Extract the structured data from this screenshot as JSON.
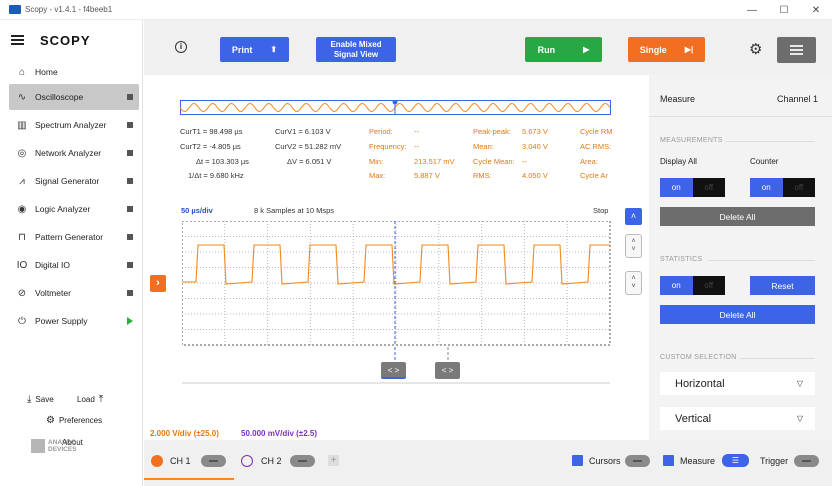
{
  "window": {
    "title": "Scopy - v1.4.1 - f4beeb1",
    "min_glyph": "—",
    "max_glyph": "☐",
    "close_glyph": "✕"
  },
  "sidebar": {
    "brand": "SCOPY",
    "home": "Home",
    "items": [
      {
        "label": "Oscilloscope",
        "icon": "oscilloscope-icon",
        "status": "stopped"
      },
      {
        "label": "Spectrum Analyzer",
        "icon": "spectrum-analyzer-icon",
        "status": "stopped"
      },
      {
        "label": "Network Analyzer",
        "icon": "network-analyzer-icon",
        "status": "stopped"
      },
      {
        "label": "Signal Generator",
        "icon": "signal-generator-icon",
        "status": "stopped"
      },
      {
        "label": "Logic Analyzer",
        "icon": "logic-analyzer-icon",
        "status": "stopped"
      },
      {
        "label": "Pattern Generator",
        "icon": "pattern-generator-icon",
        "status": "stopped"
      },
      {
        "label": "Digital IO",
        "icon": "digital-io-icon",
        "status": "stopped"
      },
      {
        "label": "Voltmeter",
        "icon": "voltmeter-icon",
        "status": "stopped"
      },
      {
        "label": "Power Supply",
        "icon": "power-supply-icon",
        "status": "running"
      }
    ],
    "save": "Save",
    "load": "Load",
    "preferences": "Preferences",
    "about": "About",
    "logo_line1": "ANALOG",
    "logo_line2": "DEVICES"
  },
  "toolbar": {
    "print": "Print",
    "mixed_signal_line1": "Enable Mixed",
    "mixed_signal_line2": "Signal View",
    "run": "Run",
    "single": "Single",
    "colors": {
      "blue": "#3d63e6",
      "green": "#27a844",
      "orange": "#f26f21"
    }
  },
  "cursors": {
    "curT1": "CurT1 = 98.498 µs",
    "curT2": "CurT2 = -4.805 µs",
    "deltaT": "Δt = 103.303 µs",
    "invDeltaT": "1/Δt = 9.680 kHz",
    "curV1": "CurV1 = 6.103 V",
    "curV2": "CurV2 = 51.282 mV",
    "deltaV": "ΔV = 6.051 V"
  },
  "measurements": {
    "period_label": "Period:",
    "period_value": "--",
    "frequency_label": "Frequency:",
    "frequency_value": "--",
    "min_label": "Min:",
    "min_value": "213.517 mV",
    "max_label": "Max:",
    "max_value": "5.887 V",
    "pkpk_label": "Peak-peak:",
    "pkpk_value": "5.673 V",
    "mean_label": "Mean:",
    "mean_value": "3.040 V",
    "cycle_mean_label": "Cycle Mean:",
    "cycle_mean_value": "--",
    "rms_label": "RMS:",
    "rms_value": "4.050 V",
    "cycle_rms_label": "Cycle RM",
    "ac_rms_label": "AC RMS:",
    "area_label": "Area:",
    "cycle_area_label": "Cycle Ar"
  },
  "plot": {
    "timebase": "50 µs/div",
    "samples": "8 k Samples at 10 Msps",
    "status": "Stop",
    "ch1_scale": "2.000 V/div (±25.0)",
    "ch2_scale": "50.000 mV/div (±2.5)",
    "trigger_marker_glyph": "›",
    "cursor_handle_glyph": "< >",
    "scroll_up": "˄",
    "scroll_down": "˅",
    "colors": {
      "ch1": "#f28a1e",
      "ch2": "#7b2fbf",
      "cursor": "#3d63e6"
    }
  },
  "right_panel": {
    "title": "Measure",
    "channel": "Channel 1",
    "measurements_section": "MEASUREMENTS",
    "display_all": "Display All",
    "counter": "Counter",
    "toggle_on": "on",
    "toggle_off": "off",
    "delete_all": "Delete All",
    "statistics_section": "STATISTICS",
    "reset": "Reset",
    "custom_section": "CUSTOM SELECTION",
    "horizontal": "Horizontal",
    "vertical": "Vertical"
  },
  "bottom": {
    "ch1": "CH 1",
    "ch2": "CH 2",
    "add_glyph": "+",
    "cursors": "Cursors",
    "measure": "Measure",
    "trigger": "Trigger"
  }
}
